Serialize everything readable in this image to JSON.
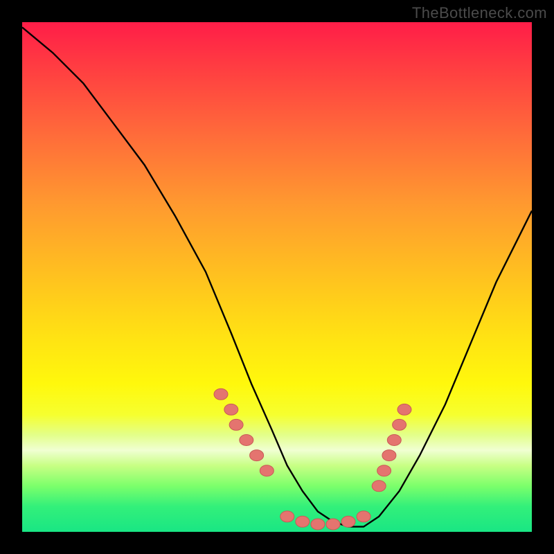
{
  "watermark": "TheBottleneck.com",
  "chart_data": {
    "type": "line",
    "title": "",
    "xlabel": "",
    "ylabel": "",
    "xlim": [
      0,
      100
    ],
    "ylim": [
      0,
      100
    ],
    "grid": false,
    "legend": false,
    "series": [
      {
        "name": "curve",
        "x": [
          0,
          6,
          12,
          18,
          24,
          30,
          36,
          41,
          45,
          49,
          52,
          55,
          58,
          61,
          64,
          67,
          70,
          74,
          78,
          83,
          88,
          93,
          98,
          100
        ],
        "y": [
          99,
          94,
          88,
          80,
          72,
          62,
          51,
          39,
          29,
          20,
          13,
          8,
          4,
          2,
          1,
          1,
          3,
          8,
          15,
          25,
          37,
          49,
          59,
          63
        ]
      }
    ],
    "markers": [
      {
        "x": 39,
        "y": 27
      },
      {
        "x": 41,
        "y": 24
      },
      {
        "x": 42,
        "y": 21
      },
      {
        "x": 44,
        "y": 18
      },
      {
        "x": 46,
        "y": 15
      },
      {
        "x": 48,
        "y": 12
      },
      {
        "x": 52,
        "y": 3
      },
      {
        "x": 55,
        "y": 2
      },
      {
        "x": 58,
        "y": 1.5
      },
      {
        "x": 61,
        "y": 1.5
      },
      {
        "x": 64,
        "y": 2
      },
      {
        "x": 67,
        "y": 3
      },
      {
        "x": 70,
        "y": 9
      },
      {
        "x": 71,
        "y": 12
      },
      {
        "x": 72,
        "y": 15
      },
      {
        "x": 73,
        "y": 18
      },
      {
        "x": 74,
        "y": 21
      },
      {
        "x": 75,
        "y": 24
      }
    ],
    "background_gradient": {
      "direction": "vertical",
      "stops": [
        {
          "pos": 0,
          "color": "#ff1d48"
        },
        {
          "pos": 50,
          "color": "#ffc21f"
        },
        {
          "pos": 71,
          "color": "#fff80c"
        },
        {
          "pos": 84,
          "color": "#f0ffd2"
        },
        {
          "pos": 100,
          "color": "#19e684"
        }
      ]
    }
  }
}
